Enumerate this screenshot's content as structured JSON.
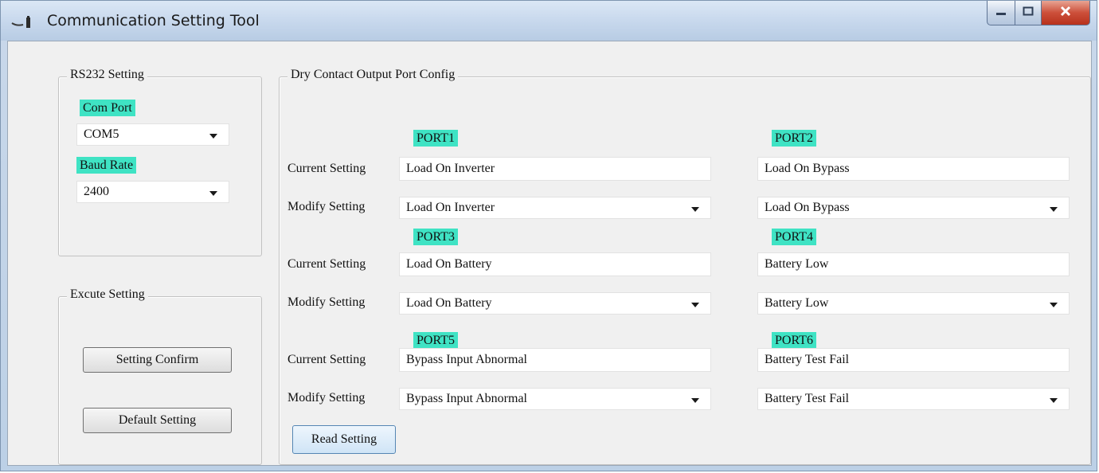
{
  "window": {
    "title": "Communication Setting Tool"
  },
  "rs232": {
    "group_label": "RS232 Setting",
    "com_port_label": "Com Port",
    "com_port_value": "COM5",
    "baud_rate_label": "Baud Rate",
    "baud_rate_value": "2400"
  },
  "execute": {
    "group_label": "Excute Setting",
    "confirm_label": "Setting Confirm",
    "default_label": "Default Setting"
  },
  "dry_contact": {
    "group_label": "Dry Contact Output Port Config",
    "current_label": "Current Setting",
    "modify_label": "Modify Setting",
    "read_label": "Read Setting",
    "ports": [
      {
        "name": "PORT1",
        "current": "Load On Inverter",
        "modify": "Load On Inverter"
      },
      {
        "name": "PORT2",
        "current": "Load On Bypass",
        "modify": "Load On Bypass"
      },
      {
        "name": "PORT3",
        "current": "Load On Battery",
        "modify": "Load On Battery"
      },
      {
        "name": "PORT4",
        "current": "Battery Low",
        "modify": "Battery Low"
      },
      {
        "name": "PORT5",
        "current": "Bypass Input Abnormal",
        "modify": "Bypass Input Abnormal"
      },
      {
        "name": "PORT6",
        "current": "Battery Test Fail",
        "modify": "Battery Test Fail"
      }
    ]
  },
  "colors": {
    "label_highlight": "#3fe3c4",
    "close_button": "#cc4f3a"
  }
}
